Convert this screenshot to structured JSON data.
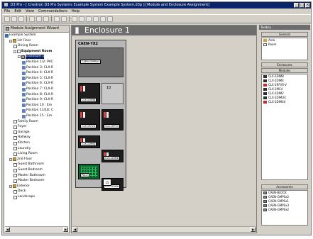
{
  "window": {
    "title": "D3 Pro - [ Crestron D3 Pro Systems Example System Example System.d3p ]  [Module and Enclosure Assignment]",
    "buttons": [
      "_",
      "□",
      "×"
    ]
  },
  "menu": [
    "File",
    "Edit",
    "View",
    "Commandations",
    "Help"
  ],
  "left_panel": {
    "title": "Module Assignment Wizard",
    "tree": [
      {
        "label": "Example System",
        "level": 0,
        "icon": "system-icon",
        "expander": ""
      },
      {
        "label": "1st Floor",
        "level": 1,
        "icon": "floor-icon",
        "expander": "-"
      },
      {
        "label": "Dining Room",
        "level": 2,
        "icon": "room-icon",
        "expander": ""
      },
      {
        "label": "Equipment Room",
        "level": 2,
        "icon": "room-icon",
        "expander": "-",
        "bold": true
      },
      {
        "label": "Enclosure 1",
        "level": 3,
        "icon": "enclosure-icon",
        "expander": "-",
        "selected": true
      },
      {
        "label": "Position 1/2: PAC",
        "level": 4,
        "icon": "position-icon",
        "expander": ""
      },
      {
        "label": "Position 3: CLX-R",
        "level": 4,
        "icon": "position-icon",
        "expander": ""
      },
      {
        "label": "Position 4: CLX-R",
        "level": 4,
        "icon": "position-icon",
        "expander": ""
      },
      {
        "label": "Position 5: CLX-R",
        "level": 4,
        "icon": "position-icon",
        "expander": ""
      },
      {
        "label": "Position 6: CLX-R",
        "level": 4,
        "icon": "position-icon",
        "expander": ""
      },
      {
        "label": "Position 7: CLX-R",
        "level": 4,
        "icon": "position-icon",
        "expander": ""
      },
      {
        "label": "Position 8: CLX-R",
        "level": 4,
        "icon": "position-icon",
        "expander": ""
      },
      {
        "label": "Position 9: CLX-R",
        "level": 4,
        "icon": "position-icon",
        "expander": ""
      },
      {
        "label": "Position 10 : Em",
        "level": 4,
        "icon": "position-icon",
        "expander": ""
      },
      {
        "label": "Position 11/18: C",
        "level": 4,
        "icon": "position-icon",
        "expander": ""
      },
      {
        "label": "Position 15 : Em",
        "level": 4,
        "icon": "position-icon",
        "expander": ""
      },
      {
        "label": "Family Room",
        "level": 2,
        "icon": "room-icon",
        "expander": ""
      },
      {
        "label": "Foyer",
        "level": 2,
        "icon": "room-icon",
        "expander": ""
      },
      {
        "label": "Garage",
        "level": 2,
        "icon": "room-icon",
        "expander": ""
      },
      {
        "label": "Hallway",
        "level": 2,
        "icon": "room-icon",
        "expander": ""
      },
      {
        "label": "Kitchen",
        "level": 2,
        "icon": "room-icon",
        "expander": ""
      },
      {
        "label": "Laundry",
        "level": 2,
        "icon": "room-icon",
        "expander": ""
      },
      {
        "label": "Living Room",
        "level": 2,
        "icon": "room-icon",
        "expander": ""
      },
      {
        "label": "2nd Floor",
        "level": 1,
        "icon": "floor-icon",
        "expander": "-"
      },
      {
        "label": "Guest Bathroom",
        "level": 2,
        "icon": "room-icon",
        "expander": ""
      },
      {
        "label": "Guest Bedroom",
        "level": 2,
        "icon": "room-icon",
        "expander": ""
      },
      {
        "label": "Master Bathroom",
        "level": 2,
        "icon": "room-icon",
        "expander": ""
      },
      {
        "label": "Master Bedroom",
        "level": 2,
        "icon": "room-icon",
        "expander": ""
      },
      {
        "label": "Exterior",
        "level": 1,
        "icon": "floor-icon",
        "expander": "-"
      },
      {
        "label": "Deck",
        "level": 2,
        "icon": "room-icon",
        "expander": ""
      },
      {
        "label": "Landscape",
        "level": 2,
        "icon": "room-icon",
        "expander": ""
      }
    ]
  },
  "center": {
    "title": "Enclosure 1",
    "enclosure": {
      "model": "CAEN-7X2",
      "top_module": "CAEN-GMPSx2",
      "slots": [
        {
          "name": "slot-3",
          "label": "CLX-1DIM8",
          "empty": false
        },
        {
          "name": "slot-4",
          "label": "10",
          "empty": true
        },
        {
          "name": "slot-5",
          "label": "CLX-1RFVS",
          "empty": false
        },
        {
          "name": "slot-6",
          "label": "CLX-1RFVS",
          "empty": false
        },
        {
          "name": "slot-7",
          "label": "CLX-1DIM4",
          "empty": false
        },
        {
          "name": "slot-8",
          "label": "CLX-1DIM8",
          "empty": false
        },
        {
          "name": "slot-9",
          "label": "CLX-1DIM8",
          "empty": false
        },
        {
          "name": "slot-10",
          "label": "CLX-1DIM8",
          "empty": false
        }
      ],
      "pac_label": "PAC2",
      "foot_label": "15"
    }
  },
  "right_panel": {
    "title": "Toolbox",
    "general": {
      "title": "General",
      "items": [
        {
          "label": "Area",
          "icon": "area-icon"
        },
        {
          "label": "Room",
          "icon": "room-icon"
        }
      ]
    },
    "modules": {
      "title": "Enclosures",
      "subtitle": "Modules",
      "items": [
        {
          "label": "CLX-1DIM8",
          "icon": "module-icon"
        },
        {
          "label": "CLX-1DIM4",
          "icon": "module-icon"
        },
        {
          "label": "CLX-1RFVS-V",
          "icon": "module-red-icon"
        },
        {
          "label": "CLX-1MC4",
          "icon": "module-icon"
        },
        {
          "label": "CLX-1DIM2",
          "icon": "module-icon"
        },
        {
          "label": "CLX-1DIMU4",
          "icon": "module-icon"
        },
        {
          "label": "CLX-1DIM44",
          "icon": "module-red-icon"
        }
      ]
    },
    "accessories": {
      "title": "Accessories",
      "items": [
        {
          "label": "CAEN-BLOCK",
          "icon": "accessory-icon"
        },
        {
          "label": "CAEN-GMPSx2",
          "icon": "accessory-icon"
        },
        {
          "label": "CAEN-GMPSx1",
          "icon": "accessory-icon"
        },
        {
          "label": "CAEN-GMPSx3",
          "icon": "accessory-icon"
        },
        {
          "label": "CAEN-GMPSx2",
          "icon": "accessory-icon"
        }
      ]
    }
  }
}
